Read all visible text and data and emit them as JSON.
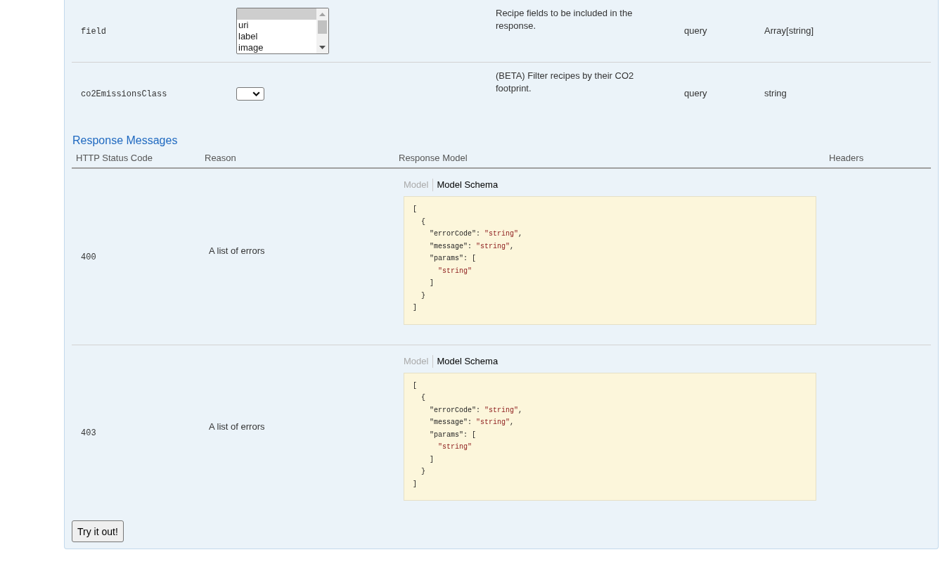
{
  "parameters": [
    {
      "name": "field",
      "value": {
        "kind": "listbox",
        "options": [
          {
            "selected": true
          },
          {
            "label": "uri",
            "selected": false
          },
          {
            "label": "label",
            "selected": false
          },
          {
            "label": "image",
            "selected": false
          }
        ]
      },
      "description": "Recipe fields to be included in the response.",
      "parameter_type": "query",
      "data_type": "Array[string]"
    },
    {
      "name": "co2EmissionsClass",
      "value": {
        "kind": "dropdown"
      },
      "description": "(BETA) Filter recipes by their CO2 footprint.",
      "parameter_type": "query",
      "data_type": "string"
    }
  ],
  "response_messages": {
    "title": "Response Messages",
    "columns": [
      "HTTP Status Code",
      "Reason",
      "Response Model",
      "Headers"
    ],
    "rows": [
      {
        "status_code": "400",
        "reason": "A list of errors",
        "model_tabs": [
          {
            "label": "Model",
            "selected": false
          },
          {
            "label": "Model Schema",
            "selected": true
          }
        ],
        "schema_lines": [
          [
            {
              "text": "[",
              "kind": "plain"
            }
          ],
          [
            {
              "text": "  {",
              "kind": "plain"
            }
          ],
          [
            {
              "text": "    \"errorCode\": ",
              "kind": "plain"
            },
            {
              "text": "\"string\"",
              "kind": "string"
            },
            {
              "text": ",",
              "kind": "plain"
            }
          ],
          [
            {
              "text": "    \"message\": ",
              "kind": "plain"
            },
            {
              "text": "\"string\"",
              "kind": "string"
            },
            {
              "text": ",",
              "kind": "plain"
            }
          ],
          [
            {
              "text": "    \"params\": [",
              "kind": "plain"
            }
          ],
          [
            {
              "text": "      \"string\"",
              "kind": "string"
            }
          ],
          [
            {
              "text": "    ]",
              "kind": "plain"
            }
          ],
          [
            {
              "text": "  }",
              "kind": "plain"
            }
          ],
          [
            {
              "text": "]",
              "kind": "plain"
            }
          ]
        ]
      },
      {
        "status_code": "403",
        "reason": "A list of errors",
        "model_tabs": [
          {
            "label": "Model",
            "selected": false
          },
          {
            "label": "Model Schema",
            "selected": true
          }
        ],
        "schema_lines": [
          [
            {
              "text": "[",
              "kind": "plain"
            }
          ],
          [
            {
              "text": "  {",
              "kind": "plain"
            }
          ],
          [
            {
              "text": "    \"errorCode\": ",
              "kind": "plain"
            },
            {
              "text": "\"string\"",
              "kind": "string"
            },
            {
              "text": ",",
              "kind": "plain"
            }
          ],
          [
            {
              "text": "    \"message\": ",
              "kind": "plain"
            },
            {
              "text": "\"string\"",
              "kind": "string"
            },
            {
              "text": ",",
              "kind": "plain"
            }
          ],
          [
            {
              "text": "    \"params\": [",
              "kind": "plain"
            }
          ],
          [
            {
              "text": "      \"string\"",
              "kind": "string"
            }
          ],
          [
            {
              "text": "    ]",
              "kind": "plain"
            }
          ],
          [
            {
              "text": "  }",
              "kind": "plain"
            }
          ],
          [
            {
              "text": "]",
              "kind": "plain"
            }
          ]
        ]
      }
    ]
  },
  "try_button": "Try it out!"
}
